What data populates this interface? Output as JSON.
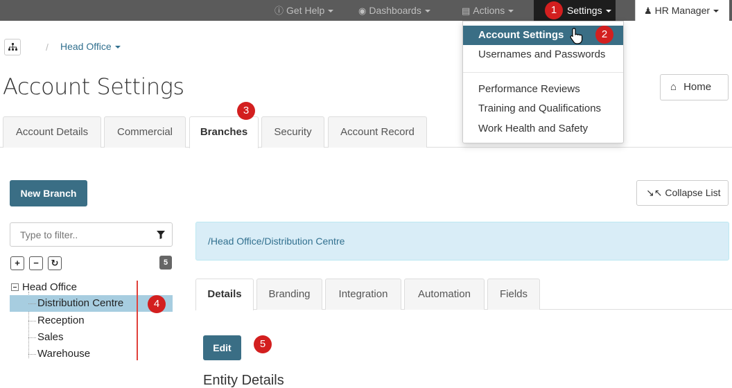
{
  "navbar": {
    "get_help": "Get Help",
    "dashboards": "Dashboards",
    "actions": "Actions",
    "settings": "Settings",
    "user": "HR Manager"
  },
  "settings_menu": {
    "items": [
      "Account Settings",
      "Usernames and Passwords"
    ],
    "items2": [
      "Performance Reviews",
      "Training and Qualifications",
      "Work Health and Safety"
    ]
  },
  "breadcrumb": {
    "current": "Head Office"
  },
  "page": {
    "title": "Account Settings",
    "home": "Home"
  },
  "tabs": [
    "Account Details",
    "Commercial",
    "Branches",
    "Security",
    "Account Record"
  ],
  "buttons": {
    "new_branch": "New Branch",
    "collapse": "Collapse List",
    "edit": "Edit"
  },
  "filter": {
    "placeholder": "Type to filter..",
    "count": "5"
  },
  "tree": {
    "root": "Head Office",
    "children": [
      "Distribution Centre",
      "Reception",
      "Sales",
      "Warehouse"
    ]
  },
  "path": "/Head Office/Distribution Centre",
  "subtabs": [
    "Details",
    "Branding",
    "Integration",
    "Automation",
    "Fields"
  ],
  "section_title": "Entity Details",
  "markers": [
    "1",
    "2",
    "3",
    "4",
    "5"
  ],
  "colors": {
    "navbar": "#5b5b5b",
    "primary": "#3a6e85",
    "selected": "#a7cde0",
    "info_bg": "#d9edf7",
    "marker": "#d31f1f"
  }
}
